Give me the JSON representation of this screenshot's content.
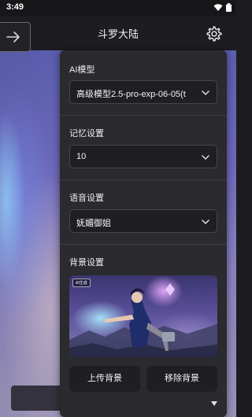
{
  "status_bar": {
    "time": "3:49",
    "icons": [
      "wifi-icon",
      "battery-icon"
    ]
  },
  "header": {
    "title": "斗罗大陆",
    "back_icon": "arrow-right-icon",
    "settings_icon": "gear-icon"
  },
  "settings_panel": {
    "ai_model": {
      "label": "AI模型",
      "value": "高级模型2.5-pro-exp-06-05(t"
    },
    "memory": {
      "label": "记忆设置",
      "value": "10"
    },
    "voice": {
      "label": "语音设置",
      "value": "妩媚御姐"
    },
    "background": {
      "label": "背景设置",
      "badge": "AI生成",
      "upload_label": "上传背景",
      "remove_label": "移除背景"
    }
  },
  "colors": {
    "panel_bg": "#2a2a2f",
    "select_bg": "#1f1f23",
    "header_bg": "#1c1c21"
  }
}
